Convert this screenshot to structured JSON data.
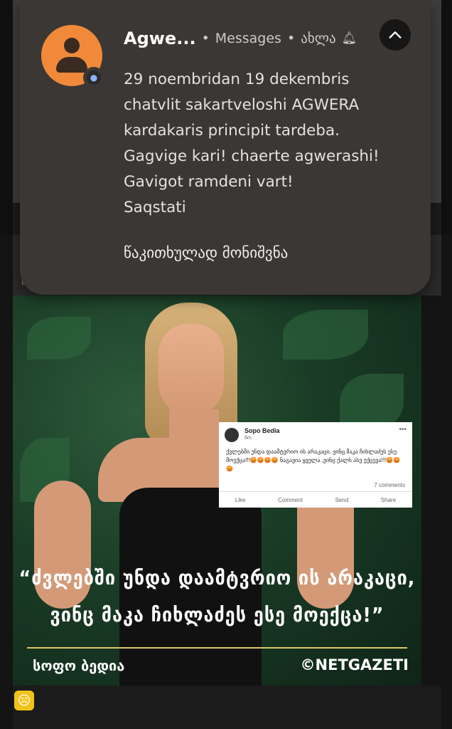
{
  "notification": {
    "sender": "Agwe...",
    "app": "Messages",
    "time": "ახლა",
    "separator": "•",
    "body_lines": [
      "29 noembridan 19 dekembris",
      "chatvlit sakartveloshi AGWERA",
      "kardakaris principit tardeba.",
      "Gagvige kari! chaerte agwerashi!",
      "Gavigot ramdeni vart!",
      "Saqstati"
    ],
    "action_label": "წაკითხულად მონიშვნა",
    "icons": {
      "avatar": "person-icon",
      "app_badge": "message-bubble-icon",
      "alert": "bell-icon",
      "collapse": "chevron-up-icon"
    },
    "colors": {
      "card": "#3b3735",
      "avatar": "#f08a3a"
    }
  },
  "post": {
    "background_text": "ბ",
    "image": {
      "facebook_card": {
        "name": "Sopo Bedia",
        "time": "6m · ",
        "text": "ქვლებში უნდა დაამტვრიო ის არაკაცი, ვინც მაკა ჩიხლაძეს ესე მოექცა!!!😡😡😡😡 ნაგავია ყველა ,ვინც ქალს ასე ექცევა!!!😡😡😡",
        "comments": "7 comments",
        "actions": [
          "Like",
          "Comment",
          "Send",
          "Share"
        ]
      },
      "quote_line1": "“ძვლებში უნდა დაამტვრიო ის არაკაცი,",
      "quote_line2": "ვინც მაკა ჩიხლაძეს ესე მოექცა!”",
      "author": "სოფო ბედია",
      "brand": "©NETGAZETI"
    },
    "reaction_icon": "sad-face-icon"
  }
}
